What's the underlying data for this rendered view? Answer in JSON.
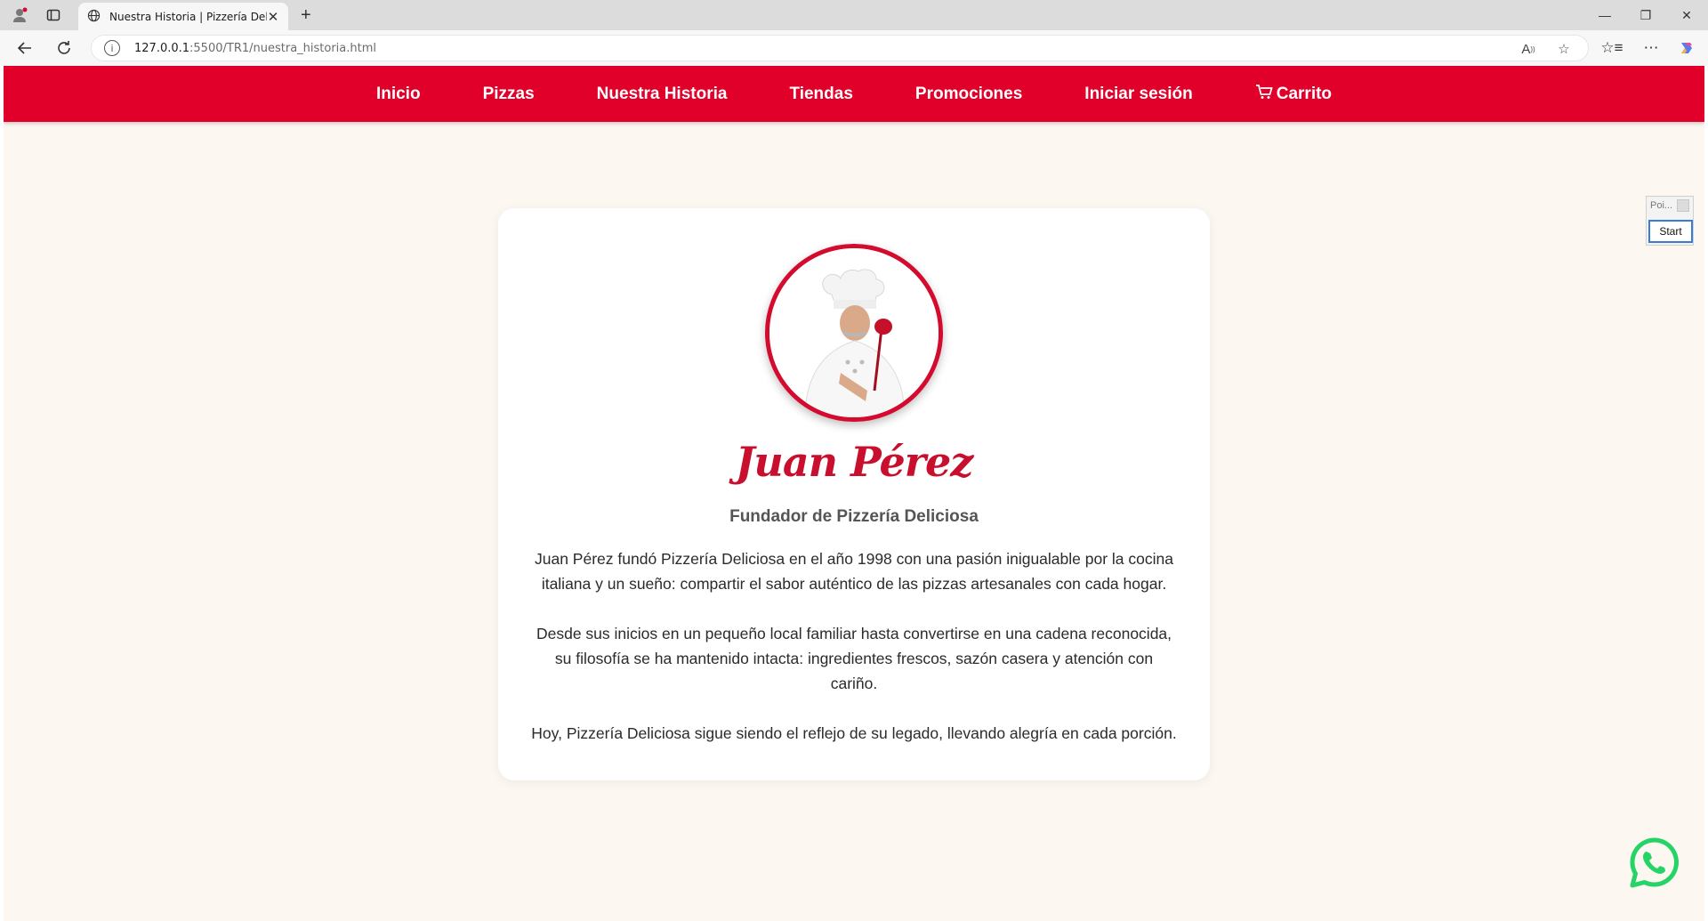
{
  "browser": {
    "tab_title": "Nuestra Historia | Pizzería Deliciosa",
    "url_host": "127.0.0.1",
    "url_rest": ":5500/TR1/nuestra_historia.html"
  },
  "nav": {
    "items": [
      "Inicio",
      "Pizzas",
      "Nuestra Historia",
      "Tiendas",
      "Promociones",
      "Iniciar sesión"
    ],
    "cart_label": "Carrito"
  },
  "founder": {
    "name": "Juan Pérez",
    "role": "Fundador de Pizzería Deliciosa",
    "bio": [
      "Juan Pérez fundó Pizzería Deliciosa en el año 1998 con una pasión inigualable por la cocina italiana y un sueño: compartir el sabor auténtico de las pizzas artesanales con cada hogar.",
      "Desde sus inicios en un pequeño local familiar hasta convertirse en una cadena reconocida, su filosofía se ha mantenido intacta: ingredientes frescos, sazón casera y atención con cariño.",
      "Hoy, Pizzería Deliciosa sigue siendo el reflejo de su legado, llevando alegría en cada porción."
    ]
  },
  "extension_widget": {
    "title": "Poi...",
    "start_label": "Start"
  },
  "colors": {
    "brand_red": "#e0002a",
    "name_red": "#c8102e",
    "page_bg": "#fdf7f1",
    "whatsapp_green": "#25d366"
  }
}
